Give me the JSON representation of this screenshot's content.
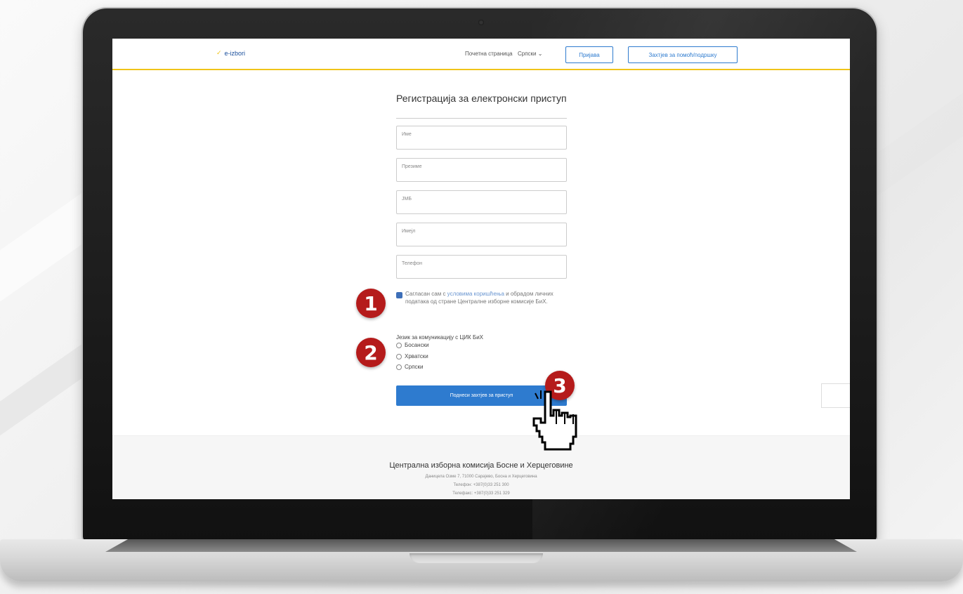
{
  "navbar": {
    "logo_text": "e-izbori",
    "home_link": "Почетна страница",
    "language_select": "Српски",
    "login_button": "Пријава",
    "request_button": "Захтјев за помоћ/подршку"
  },
  "form": {
    "title": "Регистрација за електронски приступ",
    "fields": [
      {
        "label": "Име"
      },
      {
        "label": "Презиме"
      },
      {
        "label": "JMБ"
      },
      {
        "label": "Имејл"
      },
      {
        "label": "Телефон"
      }
    ],
    "consent": {
      "checked": true,
      "prefix": "Сагласан сам с ",
      "link": "условима коришћења",
      "suffix": " и обрадом личних података од стране Централне изборне комисије БиХ."
    },
    "language": {
      "title": "Језик за комуникацију с ЦИК БиХ",
      "options": [
        "Босански",
        "Хрватски",
        "Српски"
      ]
    },
    "submit_label": "Поднеси захтјев за приступ"
  },
  "footer": {
    "title": "Централна изборна комисија Босне и Херцеговине",
    "address": "Даницела Озме 7, 71000 Сарајево, Босна и Херцеговина",
    "phone": "Телефон: +387(0)33 251 300",
    "fax": "Телефакс: +387(0)33 251 329"
  },
  "steps": [
    "1",
    "2",
    "3"
  ],
  "colors": {
    "accent": "#2e7bcf",
    "nav_underline": "#f0c419",
    "step_marker": "#b51b1b"
  }
}
